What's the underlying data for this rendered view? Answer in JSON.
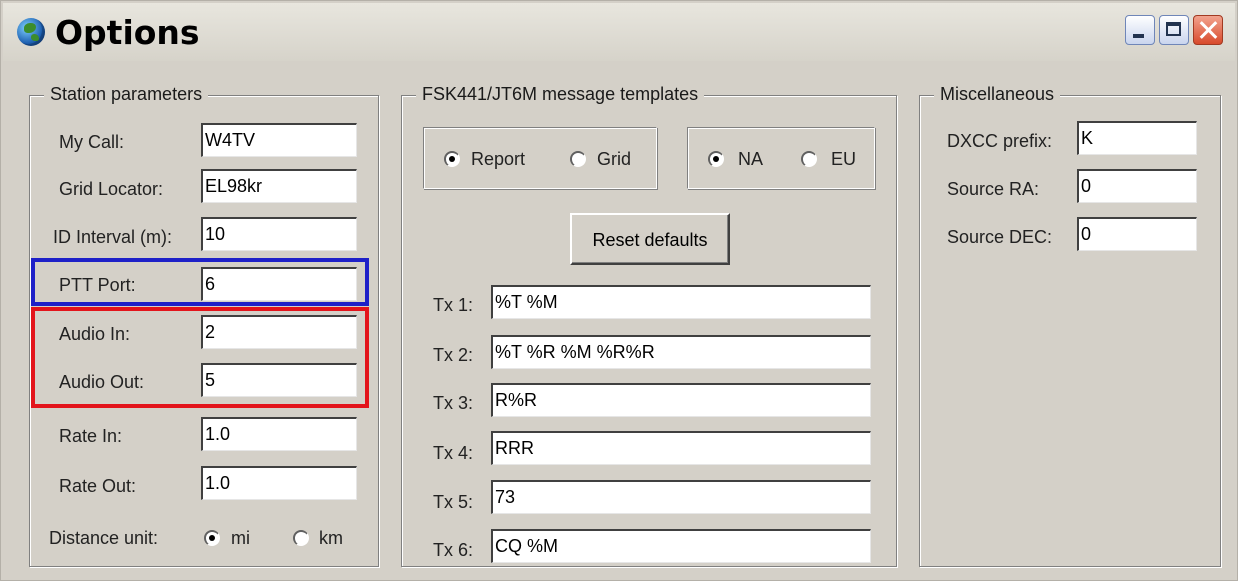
{
  "window": {
    "title": "Options"
  },
  "station": {
    "group_title": "Station parameters",
    "my_call": {
      "label": "My Call:",
      "value": "W4TV"
    },
    "grid_locator": {
      "label": "Grid Locator:",
      "value": "EL98kr"
    },
    "id_interval": {
      "label": "ID Interval (m):",
      "value": "10"
    },
    "ptt_port": {
      "label": "PTT Port:",
      "value": "6"
    },
    "audio_in": {
      "label": "Audio In:",
      "value": "2"
    },
    "audio_out": {
      "label": "Audio Out:",
      "value": "5"
    },
    "rate_in": {
      "label": "Rate In:",
      "value": "1.0"
    },
    "rate_out": {
      "label": "Rate Out:",
      "value": "1.0"
    },
    "distance_unit": {
      "label": "Distance unit:",
      "mi": "mi",
      "km": "km",
      "selected": "mi"
    }
  },
  "templates": {
    "group_title": "FSK441/JT6M message templates",
    "mode": {
      "report": "Report",
      "grid": "Grid",
      "selected": "Report"
    },
    "region": {
      "na": "NA",
      "eu": "EU",
      "selected": "NA"
    },
    "reset_label": "Reset defaults",
    "tx": [
      {
        "label": "Tx 1:",
        "value": "%T %M"
      },
      {
        "label": "Tx 2:",
        "value": "%T %R %M %R%R"
      },
      {
        "label": "Tx 3:",
        "value": "R%R"
      },
      {
        "label": "Tx 4:",
        "value": "RRR"
      },
      {
        "label": "Tx 5:",
        "value": "73"
      },
      {
        "label": "Tx 6:",
        "value": "CQ %M"
      }
    ]
  },
  "misc": {
    "group_title": "Miscellaneous",
    "dxcc_prefix": {
      "label": "DXCC prefix:",
      "value": "K"
    },
    "source_ra": {
      "label": "Source RA:",
      "value": "0"
    },
    "source_dec": {
      "label": "Source DEC:",
      "value": "0"
    }
  },
  "colors": {
    "highlight_blue": "#1e20c8",
    "highlight_red": "#e3141b",
    "dialog_bg": "#d4d0c8"
  },
  "icons": {
    "app": "globe-icon",
    "minimize": "minimize-icon",
    "maximize": "maximize-icon",
    "close": "close-icon"
  }
}
